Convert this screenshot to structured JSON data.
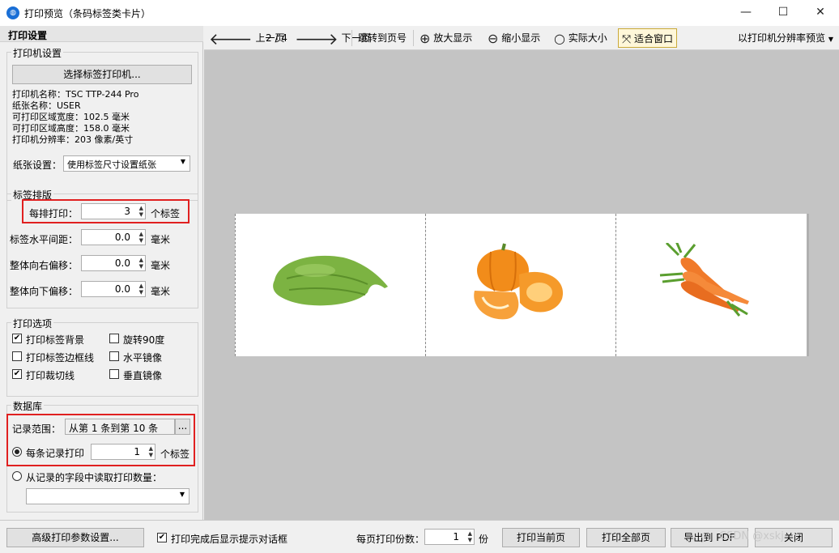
{
  "window": {
    "title": "打印预览（条码标签类卡片）",
    "minimize": "—",
    "maximize": "☐",
    "close": "✕"
  },
  "left_panel": {
    "header": "打印设置",
    "printer_group": {
      "title": "打印机设置",
      "select_button": "选择标签打印机...",
      "info": [
        "打印机名称：TSC TTP-244 Pro",
        "纸张名称：USER",
        "可打印区域宽度：102.5 毫米",
        "可打印区域高度：158.0 毫米",
        "打印机分辨率：203 像素/英寸"
      ],
      "paper_label": "纸张设置：",
      "paper_value": "使用标签尺寸设置纸张"
    },
    "layout_group": {
      "title": "标签排版",
      "rows": [
        {
          "label": "每排打印：",
          "value": "3",
          "unit": "个标签"
        },
        {
          "label": "标签水平间距：",
          "value": "0.0",
          "unit": "毫米"
        },
        {
          "label": "整体向右偏移：",
          "value": "0.0",
          "unit": "毫米"
        },
        {
          "label": "整体向下偏移：",
          "value": "0.0",
          "unit": "毫米"
        }
      ]
    },
    "options_group": {
      "title": "打印选项",
      "items": [
        {
          "label": "打印标签背景",
          "checked": true
        },
        {
          "label": "旋转90度",
          "checked": false
        },
        {
          "label": "打印标签边框线",
          "checked": false
        },
        {
          "label": "水平镜像",
          "checked": false
        },
        {
          "label": "打印裁切线",
          "checked": true
        },
        {
          "label": "垂直镜像",
          "checked": false
        }
      ]
    },
    "db_group": {
      "title": "数据库",
      "range_label": "记录范围：",
      "range_value": "从第 1 条到第 10 条",
      "range_button": "...",
      "per_record_label": "每条记录打印",
      "per_record_value": "1",
      "per_record_unit": "个标签",
      "field_label": "从记录的字段中读取打印数量："
    }
  },
  "toolbar": {
    "prev": "上一页",
    "page_info": "2 / 4",
    "next": "下一页",
    "goto": "跳转到页号",
    "zoom_in": "放大显示",
    "zoom_out": "缩小显示",
    "actual": "实际大小",
    "fit": "适合窗口",
    "resolution": "以打印机分辨率预览"
  },
  "preview": {
    "labels": [
      {
        "item": "chayote"
      },
      {
        "item": "pumpkin"
      },
      {
        "item": "carrot"
      }
    ]
  },
  "bottom": {
    "advanced": "高级打印参数设置...",
    "show_dialog": "打印完成后显示提示对话框",
    "show_dialog_checked": true,
    "copies_label": "每页打印份数：",
    "copies_value": "1",
    "copies_unit": "份",
    "print_current": "打印当前页",
    "print_all": "打印全部页",
    "export_pdf": "导出到 PDF",
    "close_btn": "关闭",
    "watermark": "CSDN @xskj"
  },
  "colors": {
    "highlight_red": "#e02020",
    "preview_bg": "#c4c4c4",
    "chayote": "#7cb342",
    "pumpkin": "#f28c1a",
    "carrot": "#f07a2a",
    "leaf": "#5a9e2f"
  }
}
